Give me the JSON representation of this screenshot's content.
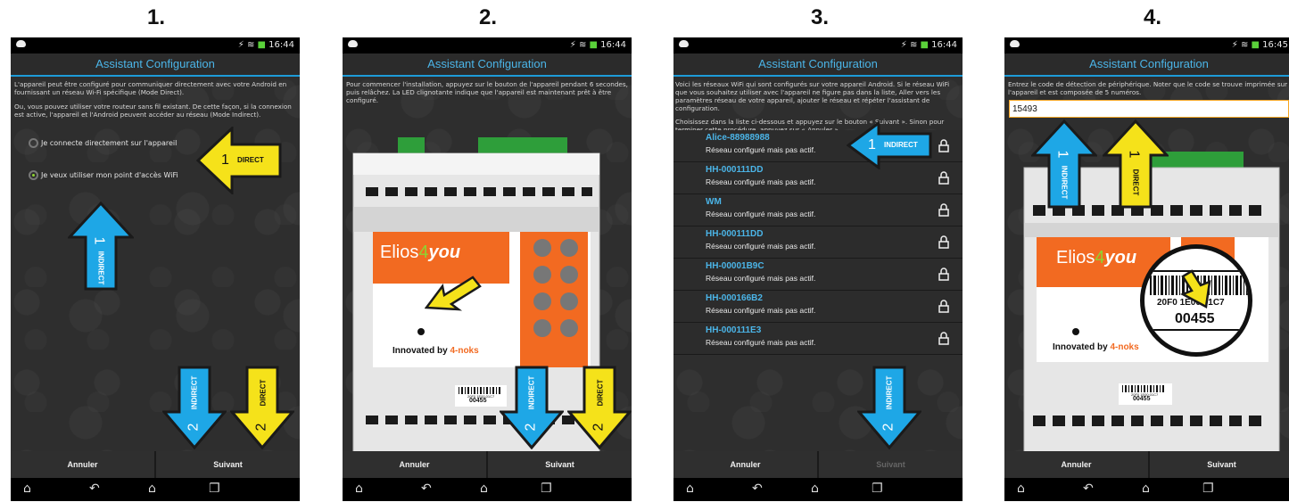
{
  "steps": [
    "1.",
    "2.",
    "3.",
    "4."
  ],
  "status": {
    "time1": "16:44",
    "time2": "16:44",
    "time3": "16:44",
    "time4": "16:45"
  },
  "app_title": "Assistant Configuration",
  "screen1": {
    "intro1": "L'appareil peut être configuré pour communiquer directement avec votre Android en fournissant un réseau Wi-Fi spécifique (Mode Direct).",
    "intro2": "Ou, vous pouvez utiliser votre routeur sans fil existant. De cette façon, si la connexion est active, l'appareil et l'Android peuvent accéder au réseau (Mode Indirect).",
    "option_direct": "Je connecte directement sur l'appareil",
    "option_indirect": "Je veux utiliser mon point d'accès WiFi"
  },
  "screen2": {
    "intro": "Pour commencer l'installation, appuyez sur le bouton de l'appareil pendant 6 secondes, puis relâchez. La LED clignotante indique que l'appareil est maintenant prêt à être configuré."
  },
  "screen3": {
    "intro1": "Voici les réseaux WiFi qui sont configurés sur votre appareil Android. Si le réseau WiFi que vous souhaitez utiliser avec l'appareil ne figure pas dans la liste, Aller vers les paramètres réseau de votre appareil, ajouter le réseau et répéter l'assistant de configuration.",
    "intro2": "Choisissez dans la liste ci-dessous et appuyez sur le bouton « Suivant ». Sinon pour terminer cette procédure, appuyez sur « Annuler ».",
    "networks": [
      {
        "name": "Alice-88988988",
        "status": "Réseau configuré mais pas actif."
      },
      {
        "name": "HH-000111DD",
        "status": "Réseau configuré mais pas actif."
      },
      {
        "name": "WM",
        "status": "Réseau configuré mais pas actif."
      },
      {
        "name": "HH-000111DD",
        "status": "Réseau configuré mais pas actif."
      },
      {
        "name": "HH-00001B9C",
        "status": "Réseau configuré mais pas actif."
      },
      {
        "name": "HH-000166B2",
        "status": "Réseau configuré mais pas actif."
      },
      {
        "name": "HH-000111E3",
        "status": "Réseau configuré mais pas actif."
      }
    ]
  },
  "screen4": {
    "intro": "Entrez le code de détection de périphérique. Noter que le code se trouve imprimée sur l'appareil et est composée de 5 numéros.",
    "code_value": "15493",
    "barcode_text": "20F0 1E00 01C7",
    "barcode_code": "00455"
  },
  "device": {
    "brand": "Elios",
    "brand_four": "4",
    "brand_you": "you",
    "tagline": "Innovated by ",
    "tagline_brand": "4-noks",
    "label_small": "20F0 1E00 01C7",
    "label_code": "00455"
  },
  "buttons": {
    "cancel": "Annuler",
    "next": "Suivant"
  },
  "arrows": {
    "direct": "DIRECT",
    "indirect": "INDIRECT",
    "n1": "1",
    "n2": "2"
  },
  "colors": {
    "blue_arrow": "#1ea7e6",
    "yellow_arrow": "#f5e21a",
    "accent": "#1d9bd8",
    "orange": "#f26a21"
  }
}
